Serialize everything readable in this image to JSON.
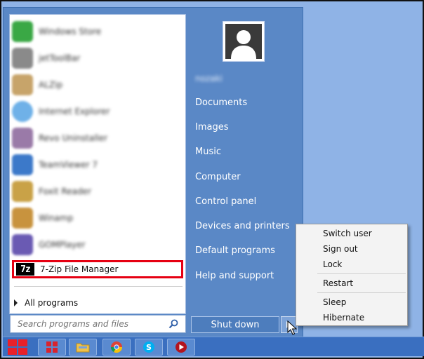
{
  "programs": [
    {
      "label": "Windows Store",
      "color": "#3aa845"
    },
    {
      "label": "jetToolBar",
      "color": "#8a8a8a"
    },
    {
      "label": "ALZip",
      "color": "#c7a46a"
    },
    {
      "label": "Internet Explorer",
      "color": "#6fb1e8"
    },
    {
      "label": "Revo Uninstaller",
      "color": "#9a7aa8"
    },
    {
      "label": "TeamViewer 7",
      "color": "#3c79c9"
    },
    {
      "label": "Foxit Reader",
      "color": "#c9a247"
    },
    {
      "label": "Winamp",
      "color": "#c8933e"
    },
    {
      "label": "GOMPlayer",
      "color": "#6a5ab3"
    }
  ],
  "highlighted_program": {
    "label": "7-Zip File Manager",
    "icon_text": "7z"
  },
  "all_programs_label": "All programs",
  "search": {
    "placeholder": "Search programs and files"
  },
  "user": {
    "name": "nozaki"
  },
  "right_links": [
    "Documents",
    "Images",
    "Music",
    "Computer",
    "Control panel",
    "Devices and printers",
    "Default programs",
    "Help and support"
  ],
  "shutdown": {
    "label": "Shut down"
  },
  "context_menu": {
    "switch_user": "Switch user",
    "sign_out": "Sign out",
    "lock": "Lock",
    "restart": "Restart",
    "sleep": "Sleep",
    "hibernate": "Hibernate"
  },
  "taskbar": {
    "items": [
      "start-icon",
      "red-app-icon",
      "folder-icon",
      "chrome-icon",
      "skype-icon",
      "player-icon"
    ]
  },
  "colors": {
    "menu_blue": "#5a88c6",
    "highlight_red": "#e60012",
    "taskbar": "#3a6fc0"
  }
}
